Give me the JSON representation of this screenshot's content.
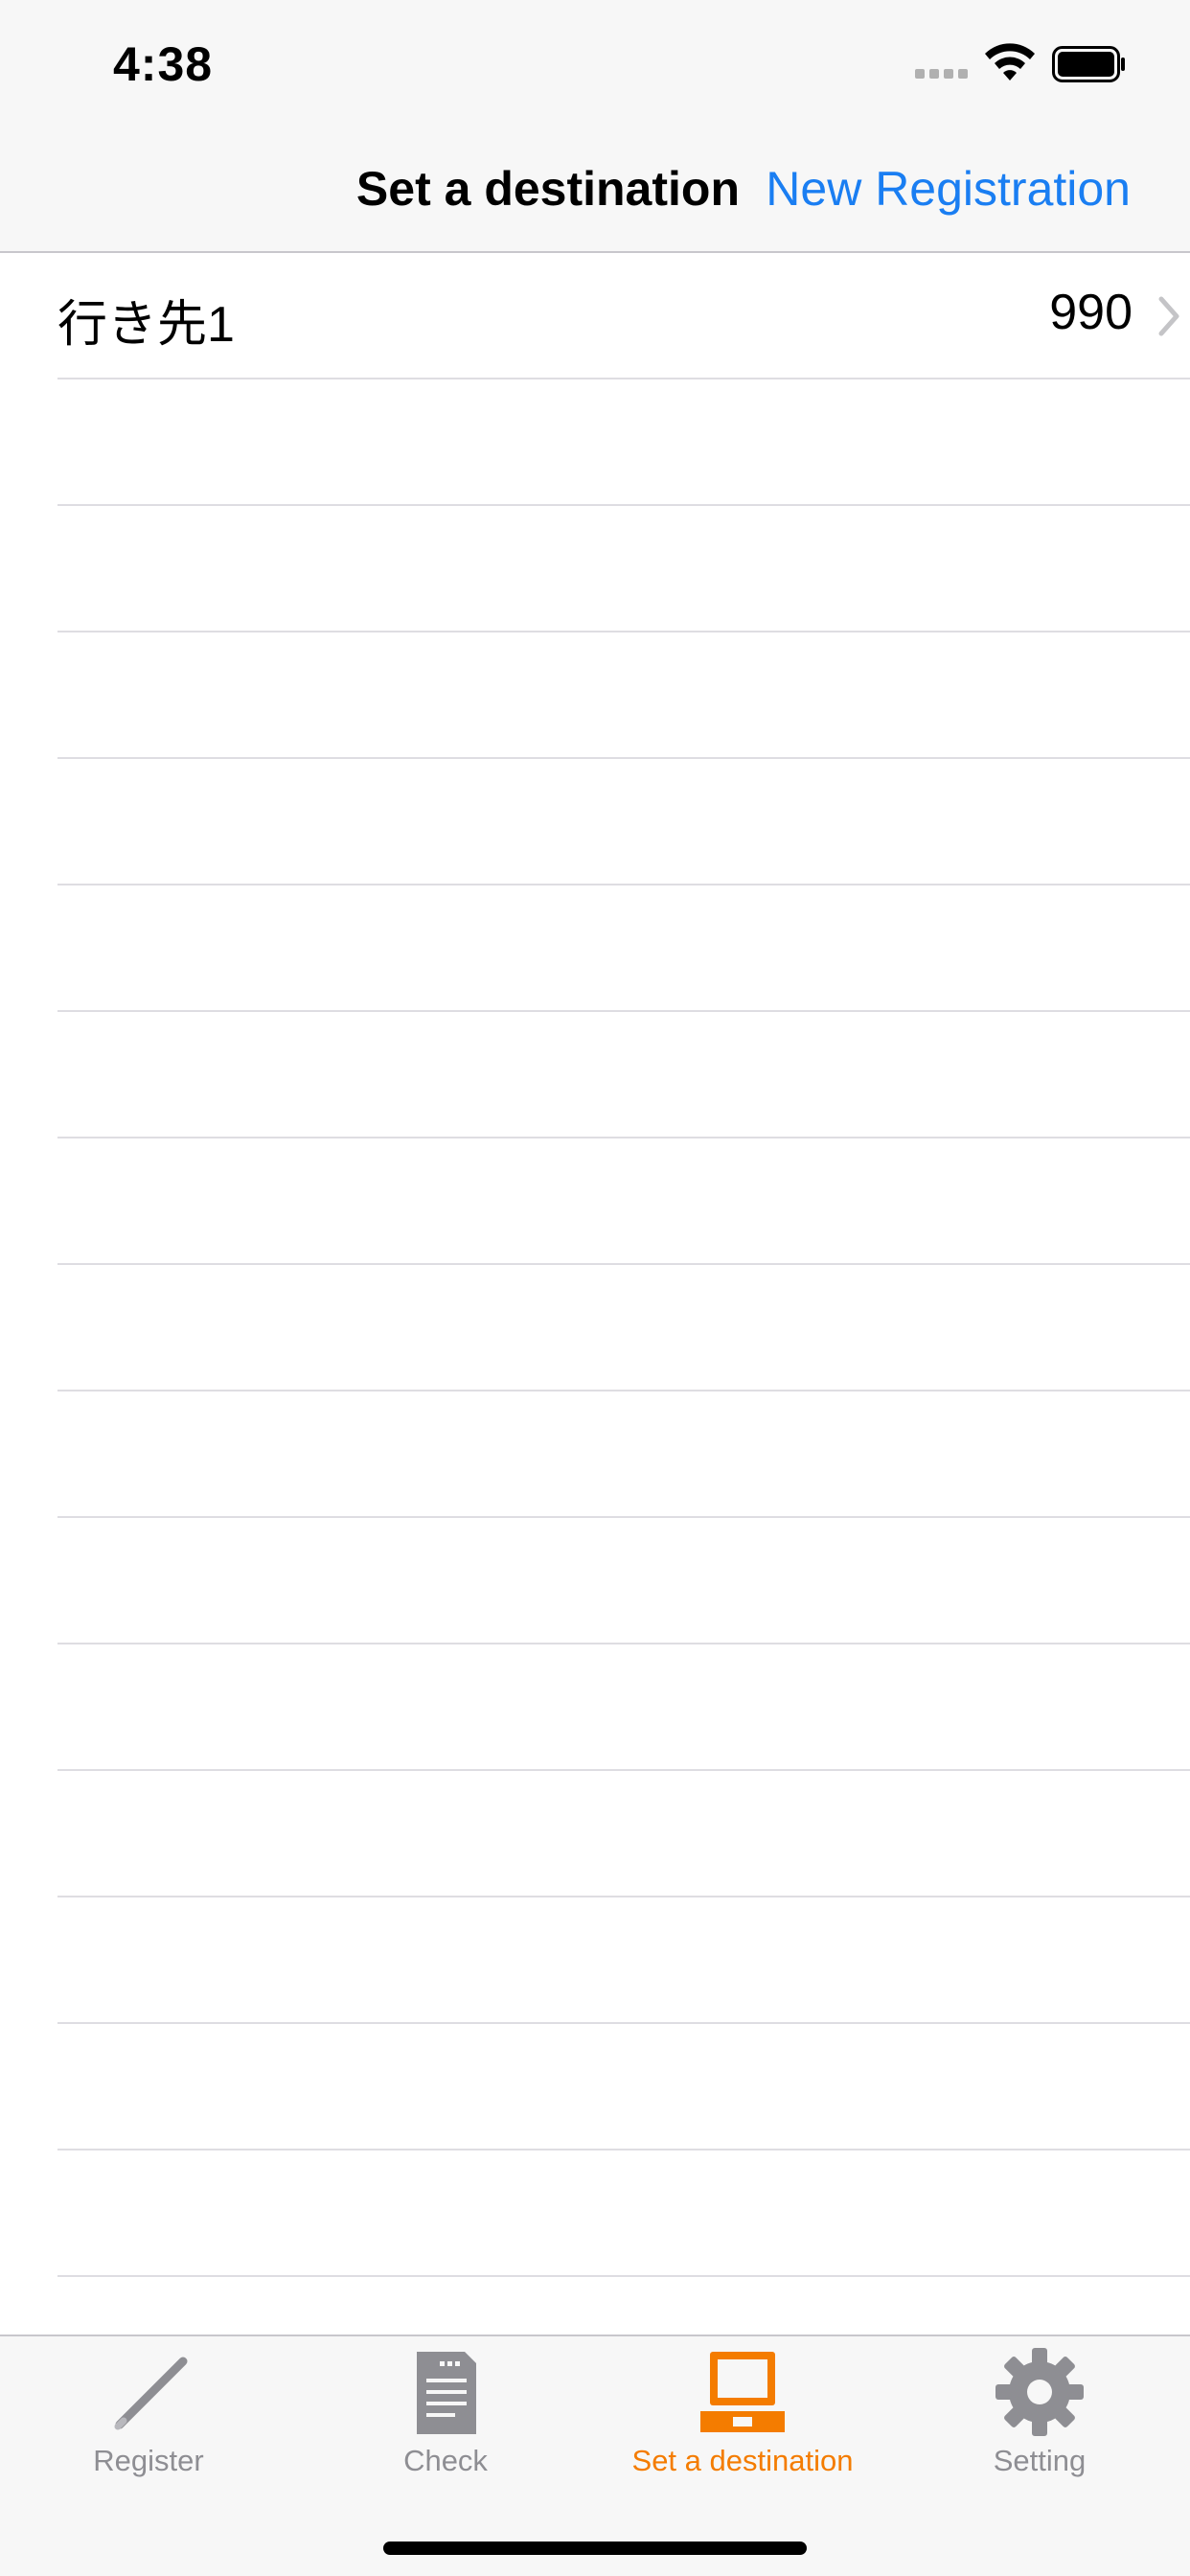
{
  "status_bar": {
    "time": "4:38"
  },
  "nav": {
    "title": "Set a destination",
    "action_label": "New Registration"
  },
  "list": {
    "rows": [
      {
        "label": "行き先1",
        "value": "990"
      }
    ]
  },
  "tabbar": {
    "tabs": [
      {
        "label": "Register",
        "icon": "pen-icon"
      },
      {
        "label": "Check",
        "icon": "document-icon"
      },
      {
        "label": "Set a destination",
        "icon": "laptop-icon"
      },
      {
        "label": "Setting",
        "icon": "gear-icon"
      }
    ],
    "active_index": 2
  },
  "colors": {
    "accent": "#1a7ef2",
    "active_tab": "#f47c00",
    "inactive_tab": "#8e8e93"
  }
}
